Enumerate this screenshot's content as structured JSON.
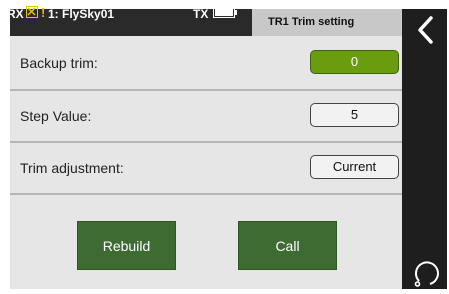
{
  "statusbar": {
    "rx_label": "RX",
    "model_label": "1: FlySky01",
    "tx_label": "TX",
    "battery_level": 1.0,
    "icons": [
      "rx-signal-lost-icon",
      "warning-icon",
      "battery-icon"
    ],
    "accent_warning": "#e6c400"
  },
  "header": {
    "title": "TR1 Trim setting"
  },
  "settings": {
    "rows": [
      {
        "label": "Backup trim:",
        "value": "0"
      },
      {
        "label": "Step Value:",
        "value": "5"
      },
      {
        "label": "Trim adjustment:",
        "value": "Current"
      }
    ]
  },
  "actions": {
    "rebuild_label": "Rebuild",
    "call_label": "Call"
  },
  "nav": {
    "icons": [
      "back-icon",
      "home-icon"
    ]
  },
  "colors": {
    "active_field": "#6a9c10",
    "button": "#3e6b32",
    "background": "#e6e6e6",
    "statusbar": "#2a2a2a",
    "sidenav": "#1e1e1e"
  }
}
